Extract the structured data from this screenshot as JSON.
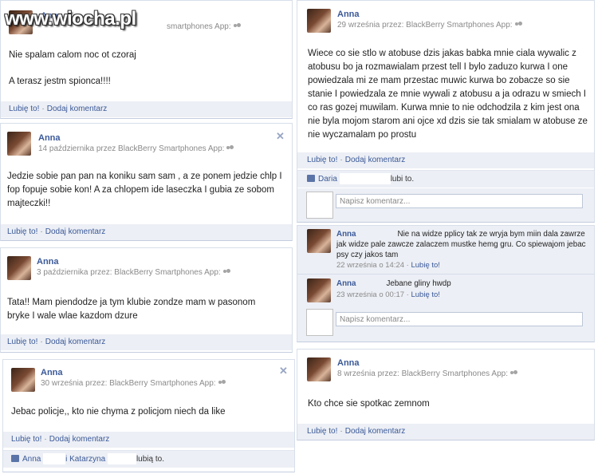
{
  "watermark": "www.wiocha.pl",
  "common": {
    "like": "Lubię to!",
    "comment": "Dodaj komentarz",
    "write_comment": "Napisz komentarz...",
    "sep": "·"
  },
  "left": [
    {
      "author": "Anna",
      "meta": "smartphones App:",
      "text1": "Nie spalam calom noc ot czoraj",
      "text2": "A terasz jestm spionca!!!!"
    },
    {
      "author": "Anna",
      "meta": "14 października przez BlackBerry Smartphones App:",
      "text": "Jedzie sobie pan pan na koniku sam sam , a ze ponem jedzie chlp I fop fopuje sobie kon! A za chlopem ide laseczka I gubia ze sobom majteczki!!"
    },
    {
      "author": "Anna",
      "meta": "3 października przez: BlackBerry Smartphones App:",
      "text": "Tata!! Mam piendodze ja tym klubie zondze mam w pasonom bryke I wale wlae kazdom dzure"
    },
    {
      "author": "Anna",
      "meta": "30 września przez: BlackBerry Smartphones App:",
      "text": "Jebac policje,, kto nie chyma z policjom niech da like",
      "likes_a": "Anna",
      "likes_b": "i Katarzyna",
      "likes_end": "lubią to."
    }
  ],
  "right": [
    {
      "author": "Anna",
      "meta": "29 września przez: BlackBerry Smartphones App:",
      "text": "Wiece co sie stlo w atobuse dzis jakas babka mnie ciala wywalic z atobusu bo ja rozmawialam przest tell I bylo zaduzo kurwa I one powiedzala mi ze mam przestac muwic kurwa bo zobacze so sie stanie I powiedzala ze mnie wywali z atobusu a ja odrazu w smiech I co ras gozej muwilam. Kurwa mnie to nie odchodzila z kim jest ona nie byla mojom starom ani ojce xd dzis sie tak smialam w atobuse ze nie wyczamalam po prostu",
      "likes_a": "Daria",
      "likes_end": "lubi to."
    },
    {
      "comments": [
        {
          "author": "Anna",
          "text": "Nie na widze pplicy tak ze wryja bym miin dala zawrze jak widze pale zawcze zalaczem mustke hemg gru. Co spiewajom jebac psy czy jakos tam",
          "time": "22 września o 14:24",
          "like": "Lubię to!"
        },
        {
          "author": "Anna",
          "text": "Jebane gliny hwdp",
          "time": "23 września o 00:17",
          "like": "Lubię to!"
        }
      ]
    },
    {
      "author": "Anna",
      "meta": "8 września przez: BlackBerry Smartphones App:",
      "text": "Kto chce sie spotkac zemnom"
    }
  ]
}
